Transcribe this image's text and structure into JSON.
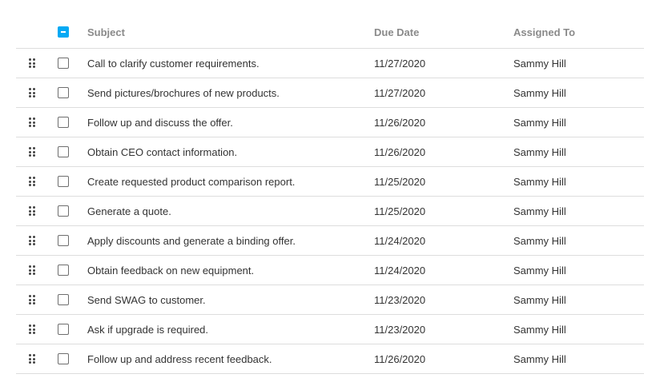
{
  "header": {
    "subject": "Subject",
    "due_date": "Due Date",
    "assigned_to": "Assigned To",
    "select_all_state": "indeterminate"
  },
  "colors": {
    "accent": "#03a9f4",
    "header_text": "#8a8a8a",
    "row_border": "#dddddd"
  },
  "icons": {
    "drag": "drag-handle-icon",
    "checkbox": "checkbox-icon"
  },
  "rows": [
    {
      "subject": "Call to clarify customer requirements.",
      "due_date": "11/27/2020",
      "assigned_to": "Sammy Hill",
      "selected": false
    },
    {
      "subject": "Send pictures/brochures of new products.",
      "due_date": "11/27/2020",
      "assigned_to": "Sammy Hill",
      "selected": false
    },
    {
      "subject": "Follow up and discuss the offer.",
      "due_date": "11/26/2020",
      "assigned_to": "Sammy Hill",
      "selected": false
    },
    {
      "subject": "Obtain CEO contact information.",
      "due_date": "11/26/2020",
      "assigned_to": "Sammy Hill",
      "selected": false
    },
    {
      "subject": "Create requested product comparison report.",
      "due_date": "11/25/2020",
      "assigned_to": "Sammy Hill",
      "selected": false
    },
    {
      "subject": "Generate a quote.",
      "due_date": "11/25/2020",
      "assigned_to": "Sammy Hill",
      "selected": false
    },
    {
      "subject": "Apply discounts and generate a binding offer.",
      "due_date": "11/24/2020",
      "assigned_to": "Sammy Hill",
      "selected": false
    },
    {
      "subject": "Obtain feedback on new equipment.",
      "due_date": "11/24/2020",
      "assigned_to": "Sammy Hill",
      "selected": false
    },
    {
      "subject": "Send SWAG to customer.",
      "due_date": "11/23/2020",
      "assigned_to": "Sammy Hill",
      "selected": false
    },
    {
      "subject": "Ask if upgrade is required.",
      "due_date": "11/23/2020",
      "assigned_to": "Sammy Hill",
      "selected": false
    },
    {
      "subject": "Follow up and address recent feedback.",
      "due_date": "11/26/2020",
      "assigned_to": "Sammy Hill",
      "selected": false
    }
  ]
}
